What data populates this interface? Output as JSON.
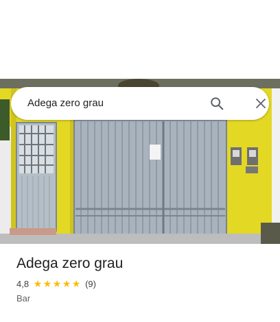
{
  "search": {
    "query": "Adega zero grau",
    "search_icon": "search-icon",
    "close_icon": "close-icon"
  },
  "photo": {
    "subject": "storefront-photo",
    "wall_color": "#e6d91f",
    "door_color": "#a7b2bd"
  },
  "place": {
    "name": "Adega zero grau",
    "rating": "4,8",
    "stars": 5,
    "reviews": "(9)",
    "category": "Bar"
  },
  "colors": {
    "star": "#fbbc04",
    "text_primary": "#202124",
    "text_secondary": "#5f6368"
  }
}
